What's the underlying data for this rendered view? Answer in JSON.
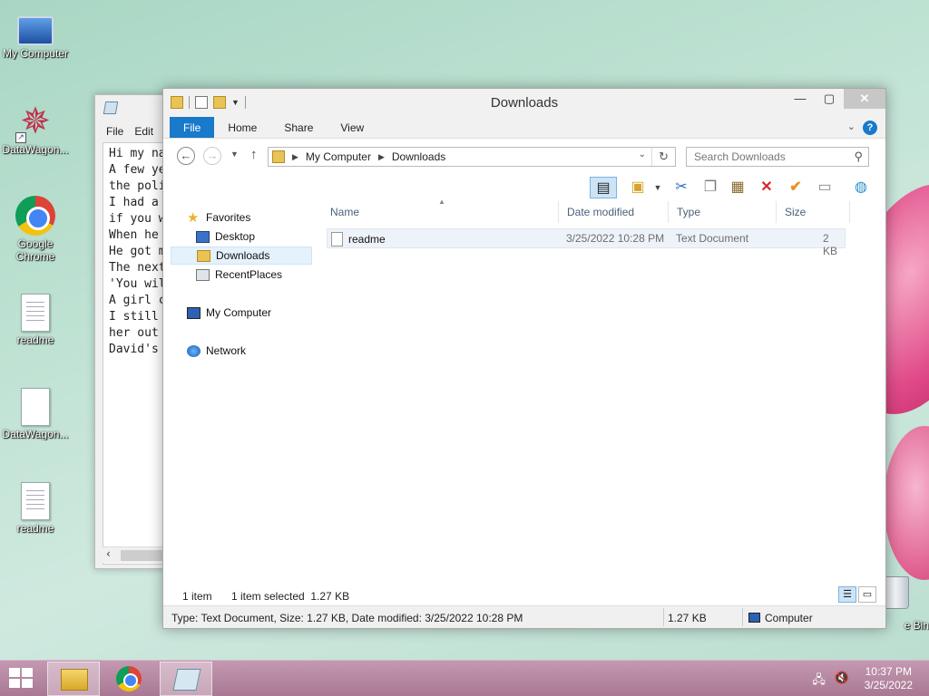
{
  "desktop": {
    "icons": [
      {
        "label": "My Computer",
        "icon": "computer-icon"
      },
      {
        "label": "DataWagon...",
        "icon": "datawagon-icon"
      },
      {
        "label": "Google Chrome",
        "icon": "chrome-icon"
      },
      {
        "label": "readme",
        "icon": "text-file-icon"
      },
      {
        "label": "DataWagon...",
        "icon": "blank-file-icon"
      },
      {
        "label": "readme",
        "icon": "text-file-icon"
      }
    ],
    "recycle_bin_label": "e Bin"
  },
  "notepad": {
    "menu": {
      "file": "File",
      "edit": "Edit"
    },
    "text": "Hi my na\nA few ye\nthe poli\nI had a \nif you w\nWhen he \nHe got m\nThe next\n'You wil\nA girl c\nI still \nher out \nDavid's "
  },
  "explorer": {
    "title": "Downloads",
    "ribbon_tabs": {
      "file": "File",
      "home": "Home",
      "share": "Share",
      "view": "View"
    },
    "help": "?",
    "address": {
      "root": "My Computer",
      "current": "Downloads"
    },
    "search_placeholder": "Search Downloads",
    "nav": {
      "favorites": "Favorites",
      "desktop": "Desktop",
      "downloads": "Downloads",
      "recent": "RecentPlaces",
      "my_computer": "My Computer",
      "network": "Network"
    },
    "columns": {
      "name": "Name",
      "date": "Date modified",
      "type": "Type",
      "size": "Size"
    },
    "files": [
      {
        "name": "readme",
        "date": "3/25/2022 10:28 PM",
        "type": "Text Document",
        "size": "2 KB"
      }
    ],
    "status": {
      "count": "1 item",
      "selected": "1 item selected  1.27 KB"
    },
    "details_bar": {
      "info": "Type: Text Document, Size: 1.27 KB, Date modified: 3/25/2022 10:28 PM",
      "size": "1.27 KB",
      "location": "Computer"
    }
  },
  "taskbar": {
    "time": "10:37 PM",
    "date": "3/25/2022"
  },
  "colors": {
    "accent": "#1979ca",
    "taskbar": "#b88da6"
  }
}
